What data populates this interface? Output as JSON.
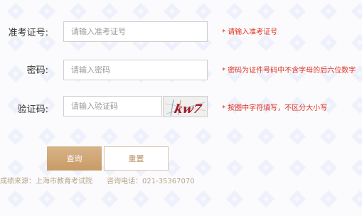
{
  "form": {
    "admission_label": "准考证号:",
    "admission_placeholder": "请输入准考证号",
    "admission_hint": "* 请输入准考证号",
    "password_label": "密码:",
    "password_placeholder": "请输入密码",
    "password_hint": "* 密码为证件号码中不含字母的后六位数字",
    "captcha_label": "验证码:",
    "captcha_placeholder": "请输入验证码",
    "captcha_hint": "* 按图中字符填写，不区分大小写",
    "captcha_text": "kw7"
  },
  "buttons": {
    "query": "查询",
    "reset": "重置"
  },
  "footer": {
    "source": "成绩来源：上海市教育考试院",
    "phone": "咨询电话：021-35367070"
  },
  "colors": {
    "accent": "#c89a66",
    "hint": "#e0301e",
    "captcha_text": "#9b1c2c"
  }
}
